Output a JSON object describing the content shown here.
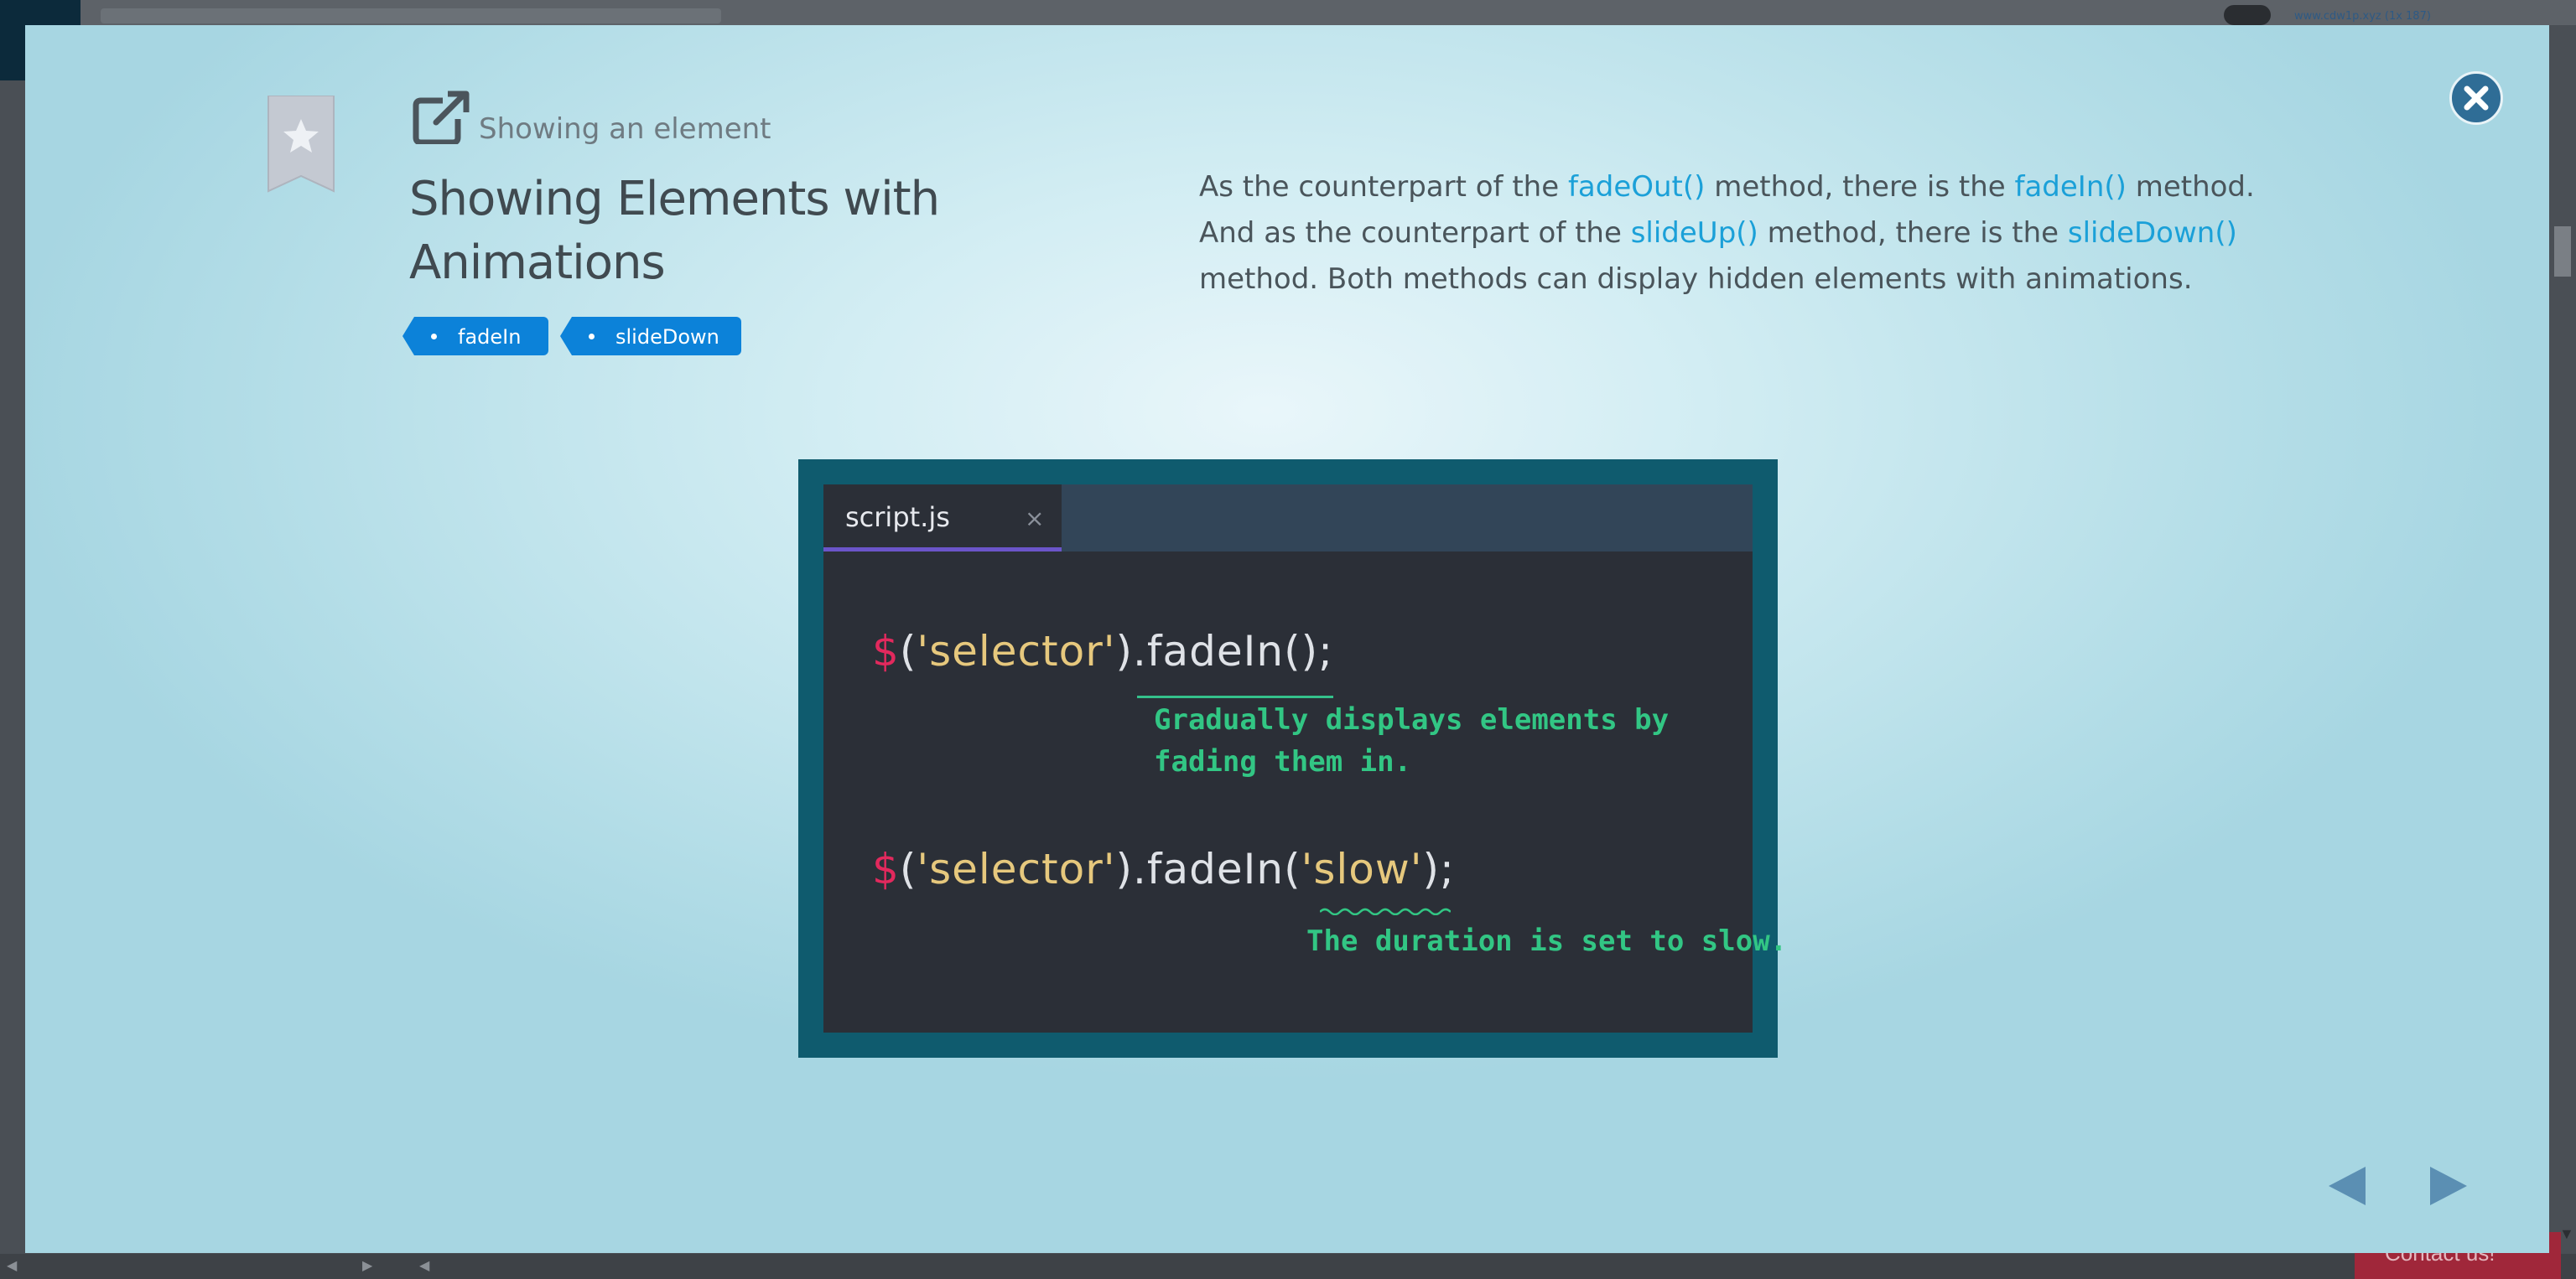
{
  "background": {
    "url_text": "www.cdw1p.xyz (1x 187)",
    "contact_label": "Contact us!"
  },
  "modal": {
    "breadcrumb": "Showing an element",
    "title": "Showing Elements with Animations",
    "tags": [
      {
        "label": "fadeIn"
      },
      {
        "label": "slideDown"
      }
    ],
    "description": {
      "p1": "As the counterpart of the ",
      "c1": "fadeOut()",
      "p2": " method, there is the ",
      "c2": "fadeIn()",
      "p3": " method. And as the counterpart of the ",
      "c3": "slideUp()",
      "p4": " method, there is the ",
      "c4": "slideDown()",
      "p5": " method. Both methods can display hidden elements with animations."
    },
    "code_illustration": {
      "tab_name": "script.js",
      "tab_close": "×",
      "line1": {
        "dollar": "$",
        "open": "(",
        "str": "'selector'",
        "rest": ").fadeIn();"
      },
      "note1": "Gradually displays elements by fading them in.",
      "line2": {
        "dollar": "$",
        "open": "(",
        "str": "'selector'",
        "mid": ").fadeIn(",
        "arg": "'slow'",
        "end": ");"
      },
      "note2": "The duration is set to slow."
    }
  },
  "colors": {
    "accent_link": "#1ba0d8",
    "tag_blue": "#0c82d9",
    "close_btn": "#2f6d96",
    "code_note_green": "#32c684"
  }
}
